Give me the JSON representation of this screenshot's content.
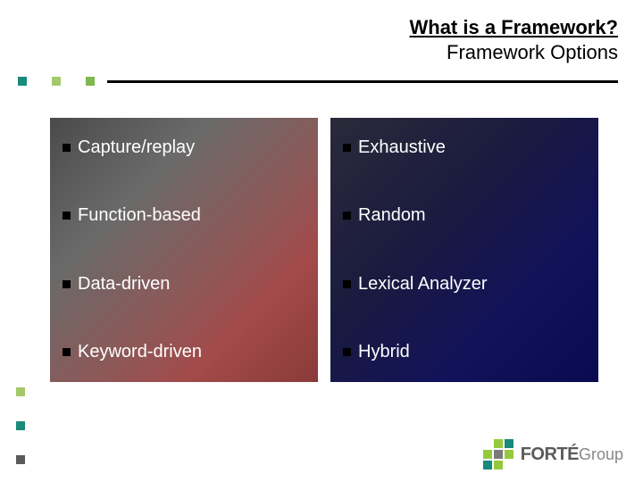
{
  "header": {
    "title": "What is a Framework?",
    "subtitle": "Framework Options"
  },
  "leftPanel": {
    "items": [
      "Capture/replay",
      "Function-based",
      "Data-driven",
      "Keyword-driven"
    ]
  },
  "rightPanel": {
    "items": [
      "Exhaustive",
      "Random",
      "Lexical Analyzer",
      "Hybrid"
    ]
  },
  "logo": {
    "primary": "FORTÉ",
    "secondary": "Group"
  }
}
